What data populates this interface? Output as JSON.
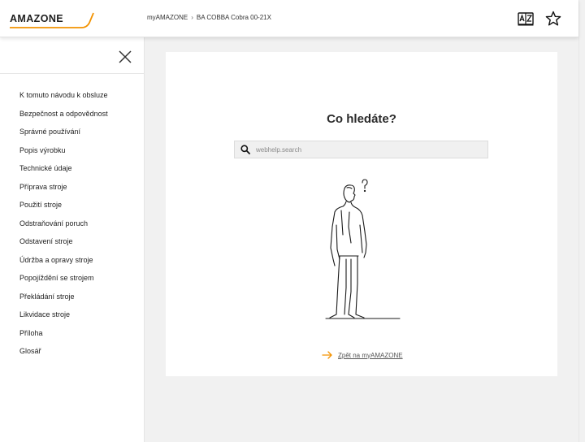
{
  "header": {
    "logo_text": "AMAZONE",
    "breadcrumb": [
      "myAMAZONE",
      "BA COBBA Cobra 00-21X"
    ],
    "breadcrumb_sep": "›",
    "icons": [
      "glossary-book-icon",
      "star-icon"
    ]
  },
  "sidebar": {
    "close_icon": "close-icon",
    "items": [
      {
        "label": "K tomuto návodu k obsluze"
      },
      {
        "label": "Bezpečnost a odpovědnost"
      },
      {
        "label": "Správné používání"
      },
      {
        "label": "Popis výrobku"
      },
      {
        "label": "Technické údaje"
      },
      {
        "label": "Příprava stroje"
      },
      {
        "label": "Použití stroje"
      },
      {
        "label": "Odstraňování poruch"
      },
      {
        "label": "Odstavení stroje"
      },
      {
        "label": "Údržba a opravy stroje"
      },
      {
        "label": "Popojíždění se strojem"
      },
      {
        "label": "Překládání stroje"
      },
      {
        "label": "Likvidace stroje"
      },
      {
        "label": "Příloha"
      },
      {
        "label": "Glosář"
      }
    ]
  },
  "main": {
    "title": "Co hledáte?",
    "search": {
      "placeholder": "webhelp.search",
      "value": ""
    },
    "back_link": "Zpět na myAMAZONE"
  },
  "colors": {
    "accent": "#f39200",
    "background": "#f1f1f1",
    "text": "#1e1e1e"
  }
}
